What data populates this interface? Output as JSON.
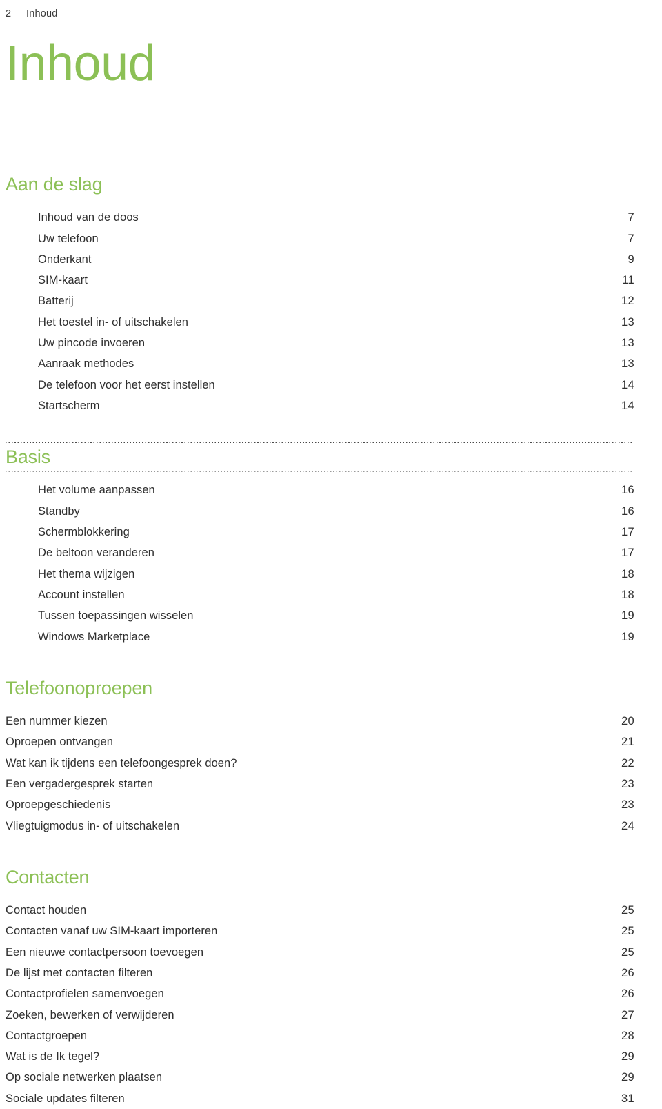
{
  "colors": {
    "accent_green": "#8cc056",
    "body_text": "#2f2f2f",
    "header_text": "#3a3a3a"
  },
  "running_header": {
    "page_number": "2",
    "title": "Inhoud"
  },
  "page_title": "Inhoud",
  "toc": {
    "sections": [
      {
        "heading": "Aan de slag",
        "indented": true,
        "entries": [
          {
            "label": "Inhoud van de doos",
            "page": "7"
          },
          {
            "label": "Uw telefoon",
            "page": "7"
          },
          {
            "label": "Onderkant",
            "page": "9"
          },
          {
            "label": "SIM-kaart",
            "page": "11"
          },
          {
            "label": "Batterij",
            "page": "12"
          },
          {
            "label": "Het toestel in- of uitschakelen",
            "page": "13"
          },
          {
            "label": "Uw pincode invoeren",
            "page": "13"
          },
          {
            "label": "Aanraak methodes",
            "page": "13"
          },
          {
            "label": "De telefoon voor het eerst instellen",
            "page": "14"
          },
          {
            "label": "Startscherm",
            "page": "14"
          }
        ]
      },
      {
        "heading": "Basis",
        "indented": true,
        "entries": [
          {
            "label": "Het volume aanpassen",
            "page": "16"
          },
          {
            "label": "Standby",
            "page": "16"
          },
          {
            "label": "Schermblokkering",
            "page": "17"
          },
          {
            "label": "De beltoon veranderen",
            "page": "17"
          },
          {
            "label": "Het thema wijzigen",
            "page": "18"
          },
          {
            "label": "Account instellen",
            "page": "18"
          },
          {
            "label": "Tussen toepassingen wisselen",
            "page": "19"
          },
          {
            "label": "Windows Marketplace",
            "page": "19"
          }
        ]
      },
      {
        "heading": "Telefoonoproepen",
        "indented": false,
        "entries": [
          {
            "label": "Een nummer kiezen",
            "page": "20"
          },
          {
            "label": "Oproepen ontvangen",
            "page": "21"
          },
          {
            "label": "Wat kan ik tijdens een telefoongesprek doen?",
            "page": "22"
          },
          {
            "label": "Een vergadergesprek starten",
            "page": "23"
          },
          {
            "label": "Oproepgeschiedenis",
            "page": "23"
          },
          {
            "label": "Vliegtuigmodus in- of uitschakelen",
            "page": "24"
          }
        ]
      },
      {
        "heading": "Contacten",
        "indented": false,
        "entries": [
          {
            "label": "Contact houden",
            "page": "25"
          },
          {
            "label": "Contacten vanaf uw SIM-kaart importeren",
            "page": "25"
          },
          {
            "label": "Een nieuwe contactpersoon toevoegen",
            "page": "25"
          },
          {
            "label": "De lijst met contacten filteren",
            "page": "26"
          },
          {
            "label": "Contactprofielen samenvoegen",
            "page": "26"
          },
          {
            "label": "Zoeken, bewerken of verwijderen",
            "page": "27"
          },
          {
            "label": "Contactgroepen",
            "page": "28"
          },
          {
            "label": "Wat is de Ik tegel?",
            "page": "29"
          },
          {
            "label": "Op sociale netwerken plaatsen",
            "page": "29"
          },
          {
            "label": "Sociale updates filteren",
            "page": "31"
          }
        ]
      }
    ]
  }
}
